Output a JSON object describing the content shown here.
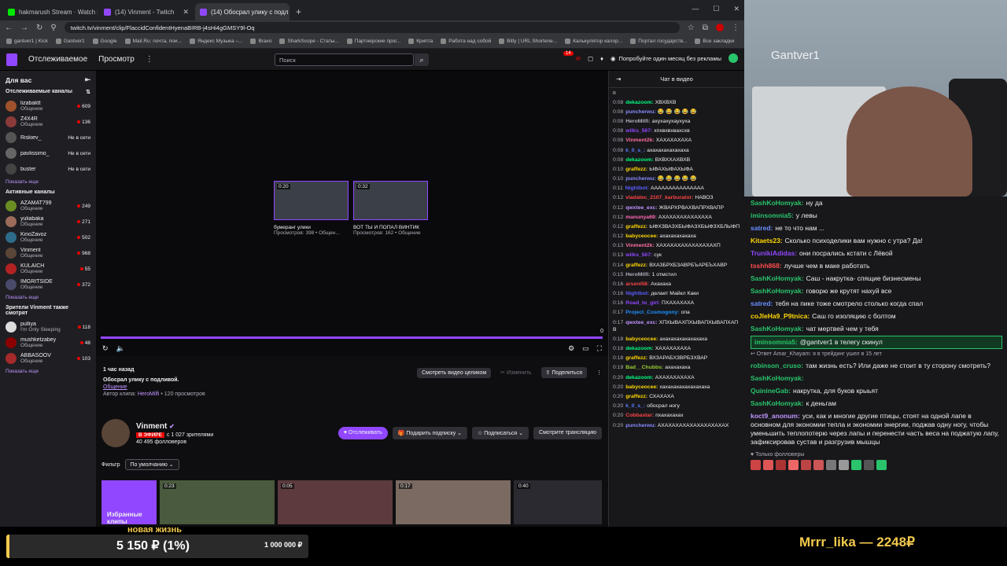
{
  "browser": {
    "tabs": [
      {
        "label": "hakmarush Stream · Watch Liv",
        "color": "#00e701",
        "active": false
      },
      {
        "label": "(14) Vinment - Twitch",
        "color": "#9147ff",
        "active": false
      },
      {
        "label": "(14) Обосрал улику с подл",
        "color": "#9147ff",
        "active": true
      }
    ],
    "url": "twitch.tv/vinment/clip/FlaccidConfidentHyenaBIRB-j4sHi4gGMSY9l-Oq",
    "bookmarks": [
      "gantver1 | Kick",
      "Gantver1",
      "Google",
      "Mail.Ru: почта, пои...",
      "Яндекс Музыка –...",
      "Bravo",
      "SharkScope - Статы...",
      "Партнерские прог...",
      "Крипта",
      "Работа над собой",
      "Bitly | URL Shortene...",
      "Калькулятор калор...",
      "Портал государств...",
      "Все закладки"
    ]
  },
  "twitch": {
    "nav": [
      "Отслеживаемое",
      "Просмотр"
    ],
    "search_placeholder": "Поиск",
    "notif_count": "14",
    "prime_text": "Попробуйте один месяц без рекламы"
  },
  "sidebar": {
    "header": "Для вас",
    "followed_title": "Отслеживаемые каналы",
    "followed": [
      {
        "name": "lizabaktt",
        "cat": "Общение",
        "viewers": "609",
        "live": true,
        "color": "#a0522d"
      },
      {
        "name": "Z4X4R",
        "cat": "Общение",
        "viewers": "136",
        "live": true,
        "color": "#8b3a3a"
      },
      {
        "name": "Riskiev_",
        "cat": "",
        "viewers": "Не в сети",
        "live": false,
        "color": "#555"
      },
      {
        "name": "pavlissimo_",
        "cat": "",
        "viewers": "Не в сети",
        "live": false,
        "color": "#666"
      },
      {
        "name": "buster",
        "cat": "",
        "viewers": "Не в сети",
        "live": false,
        "color": "#444"
      }
    ],
    "show_more": "Показать еще",
    "active_title": "Активные каналы",
    "active": [
      {
        "name": "AZAMAT799",
        "cat": "Общение",
        "viewers": "249",
        "color": "#6b8e23"
      },
      {
        "name": "yuliabaka",
        "cat": "Общение",
        "viewers": "271",
        "color": "#9c6b5a"
      },
      {
        "name": "KinoZavoz",
        "cat": "Общение",
        "viewers": "502",
        "color": "#2e6b8a"
      },
      {
        "name": "Vinment",
        "cat": "Общение",
        "viewers": "968",
        "color": "#5a4638"
      },
      {
        "name": "KULAICH",
        "cat": "Общение",
        "viewers": "55",
        "color": "#b22222"
      },
      {
        "name": "IMGRITSIDE",
        "cat": "Общение",
        "viewers": "372",
        "color": "#4a4a6a"
      }
    ],
    "also_title": "Зрители Vinment также смотрят",
    "also": [
      {
        "name": "pulliya",
        "cat": "I'm Only Sleeping",
        "viewers": "118",
        "color": "#ddd"
      },
      {
        "name": "mushketzabey",
        "cat": "Общение",
        "viewers": "48",
        "color": "#8b0000"
      },
      {
        "name": "ABBASOOV",
        "cat": "Общение",
        "viewers": "103",
        "color": "#a52a2a"
      }
    ]
  },
  "player": {
    "thumbs": [
      {
        "dur": "0:20",
        "title": "бумеранг улики",
        "stats": "Просмотров: 398 • Общен..."
      },
      {
        "dur": "0:32",
        "title": "ВОТ ТЫ И ПОПАЛ ВИНТИК",
        "stats": "Просмотров: 162 • Общение"
      }
    ],
    "time": "0"
  },
  "clip": {
    "ago": "1 час назад",
    "title": "Обосрал улику с подливой.",
    "category": "Общение",
    "author_prefix": "Автор клипа:",
    "author": "HeroMilfi",
    "views": "• 120 просмотров",
    "watch_full": "Смотреть видео целиком",
    "edit": "Изменить",
    "share": "Поделиться"
  },
  "channel": {
    "name": "Vinment",
    "live": "В ЭФИРЕ",
    "viewers": "с 1 027 зрителями",
    "followers": "40 495 фолловеров",
    "follow": "Отслеживать",
    "gift": "Подарить подписку",
    "subscribe": "Подписаться",
    "watch_stream": "Смотрите трансляцию"
  },
  "filter": {
    "label": "Фильтр",
    "value": "По умолчанию"
  },
  "clips": {
    "featured": "Избранные клипы",
    "durations": [
      "0:23",
      "0:05",
      "0:17",
      "0:40"
    ]
  },
  "chat": {
    "title": "Чат в видео",
    "messages": [
      {
        "t": "",
        "u": "",
        "m": "п",
        "c": "#efeff1"
      },
      {
        "t": "0:08",
        "u": "dekazoom:",
        "m": "ХВХВХВ",
        "c": "#00ff7f"
      },
      {
        "t": "0:08",
        "u": "puncherwu:",
        "m": "😂 😂 😂 😂 😂",
        "c": "#8a8aff"
      },
      {
        "t": "0:08",
        "u": "HeroMilfi:",
        "m": "ахухахухаухуха",
        "c": "#adadb8"
      },
      {
        "t": "0:08",
        "u": "wilks_567:",
        "m": "хпхвхвхвахсхв",
        "c": "#9147ff"
      },
      {
        "t": "0:08",
        "u": "Vinment2k:",
        "m": "ХАХАХАХАХА",
        "c": "#ff6ea0"
      },
      {
        "t": "0:08",
        "u": "k_0_s_:",
        "m": "ахахахахахахаха",
        "c": "#5c7aff"
      },
      {
        "t": "0:08",
        "u": "dekazoom:",
        "m": "ВХВХХАХВХВ",
        "c": "#00ff7f"
      },
      {
        "t": "0:10",
        "u": "graffezz:",
        "m": "ЫФАХЫФАХЫФА",
        "c": "#ffd700"
      },
      {
        "t": "0:10",
        "u": "puncherwu:",
        "m": "😂 😂 😂 😂 😂",
        "c": "#8a8aff"
      },
      {
        "t": "0:11",
        "u": "Nightbot:",
        "m": "ААААААААААААААА",
        "c": "#5c5cff"
      },
      {
        "t": "0:12",
        "u": "vladatec_2107_karburator:",
        "m": "НАВОЗ",
        "c": "#ff4444"
      },
      {
        "t": "0:12",
        "u": "qwxtee_exc:",
        "m": "ЖВАРХРВАХВАПРХВАПР",
        "c": "#bf94ff"
      },
      {
        "t": "0:12",
        "u": "manunya69:",
        "m": "АХАХАХАХАХАХАХА",
        "c": "#ff69b4"
      },
      {
        "t": "0:12",
        "u": "graffezz:",
        "m": "ЫФХЗВАЗХБЫФАЗХБЫФЗХБЛЫФП",
        "c": "#ffd700"
      },
      {
        "t": "0:12",
        "u": "babyceocee:",
        "m": "ахахахахахаха",
        "c": "#ffd700"
      },
      {
        "t": "0:13",
        "u": "Vinment2k:",
        "m": "ХАХАХАХАХАХАХАХАХП",
        "c": "#ff6ea0"
      },
      {
        "t": "0:13",
        "u": "wilks_567:",
        "m": "сук",
        "c": "#9147ff"
      },
      {
        "t": "0:14",
        "u": "graffezz:",
        "m": "ВХАЗБРХБЗАВРБЪАРБЪХАВР",
        "c": "#ffd700"
      },
      {
        "t": "0:15",
        "u": "HeroMilfi:",
        "m": "1 отмстил",
        "c": "#adadb8"
      },
      {
        "t": "0:16",
        "u": "arseni58:",
        "m": "Ахахаха",
        "c": "#ff4444"
      },
      {
        "t": "0:16",
        "u": "Nightbot:",
        "m": "делает Майкл Каки",
        "c": "#5c5cff"
      },
      {
        "t": "0:16",
        "u": "Road_to_girl:",
        "m": "ПХАХАХАХА",
        "c": "#9147ff"
      },
      {
        "t": "0:17",
        "u": "Project_Cosmogony:",
        "m": "опа",
        "c": "#1e90ff"
      },
      {
        "t": "0:17",
        "u": "qwxtee_exc:",
        "m": "ХПХЫВАХПХЫВАПХЫВАПХАПВ",
        "c": "#bf94ff"
      },
      {
        "t": "0:18",
        "u": "babyceocee:",
        "m": "ахахахахахахахаха",
        "c": "#ffd700"
      },
      {
        "t": "0:18",
        "u": "dekazoom:",
        "m": "ХАХАХАХАХА",
        "c": "#00ff7f"
      },
      {
        "t": "0:18",
        "u": "graffezz:",
        "m": "ВХЗАРАБХЗВРБЗХВАР",
        "c": "#ffd700"
      },
      {
        "t": "0:19",
        "u": "Bad__Chubbs:",
        "m": "ахахахаха",
        "c": "#9acd32"
      },
      {
        "t": "0:20",
        "u": "dekazoom:",
        "m": "АХАХАХАХАХА",
        "c": "#00ff7f"
      },
      {
        "t": "0:20",
        "u": "babyceocee:",
        "m": "хахахахахахахахаха",
        "c": "#ffd700"
      },
      {
        "t": "0:20",
        "u": "graffezz:",
        "m": "СХАХАХА",
        "c": "#ffd700"
      },
      {
        "t": "0:20",
        "u": "k_0_s_:",
        "m": "обосрал ногу",
        "c": "#5c7aff"
      },
      {
        "t": "0:20",
        "u": "Cobbastar:",
        "m": "пхахахахах",
        "c": "#ff4444"
      },
      {
        "t": "0:20",
        "u": "puncherwu:",
        "m": "АХАХАХАХАХАХАХАХАХАХ",
        "c": "#8a8aff"
      }
    ]
  },
  "overlay": {
    "streamer": "Gantver1",
    "messages": [
      {
        "u": "SashKoHomyak:",
        "m": "ну да",
        "c": "#29c46b",
        "hl": false
      },
      {
        "u": "iminsomnia5:",
        "m": "у левы",
        "c": "#29c46b",
        "hl": false
      },
      {
        "u": "satred:",
        "m": "не то что нам ...",
        "c": "#6a8cff",
        "hl": false
      },
      {
        "u": "Kitaets23:",
        "m": "Сколько психоделики вам нужно с утра? Да!",
        "c": "#ffd700",
        "hl": false
      },
      {
        "u": "TrunikiAdidas:",
        "m": "они посрались кстати с Лёвой",
        "c": "#9147ff",
        "hl": false
      },
      {
        "u": "tsshh868:",
        "m": "лучше чем в маке работать",
        "c": "#ff4d4d",
        "hl": false
      },
      {
        "u": "SashKoHomyak:",
        "m": "Саш - накрутка- спящие бизнесмены",
        "c": "#29c46b",
        "hl": false
      },
      {
        "u": "SashKoHomyak:",
        "m": "говорю же крутят нахуй все",
        "c": "#29c46b",
        "hl": false
      },
      {
        "u": "satred:",
        "m": "тебя на пике тоже смотрело столько когда спал",
        "c": "#6a8cff",
        "hl": false
      },
      {
        "u": "coJleHa9_P9tnica:",
        "m": "Саш го изоляцию с болтом",
        "c": "#ffd700",
        "hl": false
      },
      {
        "u": "SashKoHomyak:",
        "m": "чат мертвей чем у тебя",
        "c": "#29c46b",
        "hl": false
      },
      {
        "u": "iminsomnia5:",
        "m": "@gantver1 в телегу скинул",
        "c": "#29c46b",
        "hl": true
      },
      {
        "u": "robinson_cruso:",
        "m": "там жизнь есть? Или даже не стоит в ту сторону смотреть?",
        "c": "#29c46b",
        "hl": false,
        "reply": "↩ Ответ Amar_Khayam: я в трейдинг ушел в 15 лет"
      },
      {
        "u": "SashKoHomyak:",
        "m": "",
        "c": "#29c46b",
        "hl": false
      },
      {
        "u": "QuinineGab:",
        "m": "накрутка, для буков крыьят",
        "c": "#29c46b",
        "hl": false
      },
      {
        "u": "SashKoHomyak:",
        "m": "к деньгам",
        "c": "#29c46b",
        "hl": false
      },
      {
        "u": "koct9_anonum:",
        "m": "уси, как и многие другие птицы, стоят на одной лапе в основном для экономии тепла и экономии энергии, поджав одну ногу, чтобы уменьшить теплопотерю через лапы и перенести часть веса на поджатую лапу, зафиксировав сустав и разгрузив мышцы",
        "c": "#bf94ff",
        "hl": false
      }
    ],
    "followers_only": "Только фолловеры"
  },
  "goal": {
    "name": "новая жизнь",
    "value": "5 150 ₽ (1%)",
    "max": "1 000 000 ₽",
    "percent": 1
  },
  "donor": "Mrrr_lika — 2248₽"
}
